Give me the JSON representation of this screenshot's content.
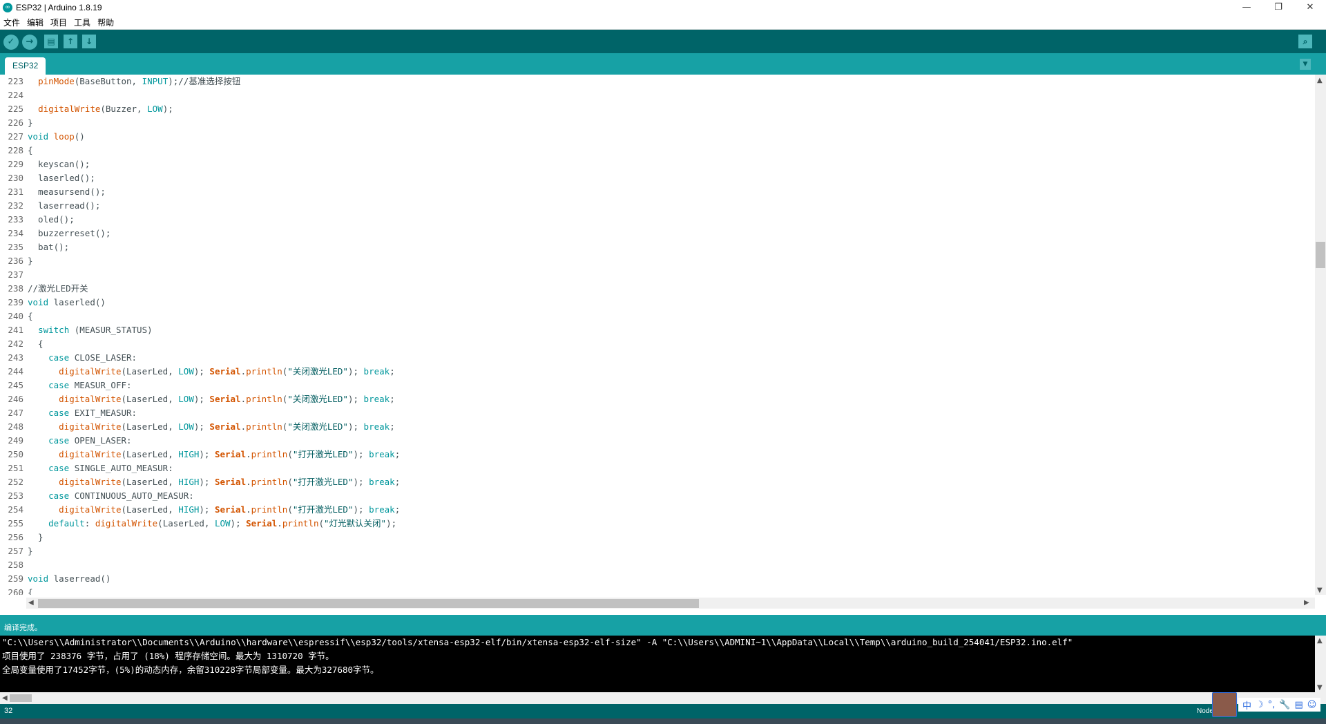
{
  "window": {
    "title": "ESP32 | Arduino 1.8.19",
    "controls": [
      "—",
      "❐",
      "✕"
    ]
  },
  "menu": [
    "文件",
    "编辑",
    "项目",
    "工具",
    "帮助"
  ],
  "toolbar": {
    "verify_icon": "✓",
    "upload_icon": "→",
    "new_icon": "▤",
    "open_icon": "↑",
    "save_icon": "↓",
    "serial_monitor_icon": "⌕"
  },
  "tab": {
    "label": "ESP32",
    "menu_icon": "▼"
  },
  "editor": {
    "lines": [
      {
        "n": "223",
        "segs": [
          [
            "  ",
            "code"
          ],
          [
            "pinMode",
            "fn"
          ],
          [
            "(BaseButton, ",
            "code"
          ],
          [
            "INPUT",
            "const"
          ],
          [
            ");//基准选择按钮",
            "code"
          ]
        ]
      },
      {
        "n": "224",
        "segs": []
      },
      {
        "n": "225",
        "segs": [
          [
            "  ",
            "code"
          ],
          [
            "digitalWrite",
            "fn"
          ],
          [
            "(Buzzer, ",
            "code"
          ],
          [
            "LOW",
            "const"
          ],
          [
            ");",
            "code"
          ]
        ]
      },
      {
        "n": "226",
        "segs": [
          [
            "}",
            "code"
          ]
        ]
      },
      {
        "n": "227",
        "segs": [
          [
            "void",
            "kw"
          ],
          [
            " ",
            "code"
          ],
          [
            "loop",
            "fn"
          ],
          [
            "()",
            "code"
          ]
        ]
      },
      {
        "n": "228",
        "segs": [
          [
            "{",
            "code"
          ]
        ]
      },
      {
        "n": "229",
        "segs": [
          [
            "  keyscan();",
            "code"
          ]
        ]
      },
      {
        "n": "230",
        "segs": [
          [
            "  laserled();",
            "code"
          ]
        ]
      },
      {
        "n": "231",
        "segs": [
          [
            "  measursend();",
            "code"
          ]
        ]
      },
      {
        "n": "232",
        "segs": [
          [
            "  laserread();",
            "code"
          ]
        ]
      },
      {
        "n": "233",
        "segs": [
          [
            "  oled();",
            "code"
          ]
        ]
      },
      {
        "n": "234",
        "segs": [
          [
            "  buzzerreset();",
            "code"
          ]
        ]
      },
      {
        "n": "235",
        "segs": [
          [
            "  bat();",
            "code"
          ]
        ]
      },
      {
        "n": "236",
        "segs": [
          [
            "}",
            "code"
          ]
        ]
      },
      {
        "n": "237",
        "segs": []
      },
      {
        "n": "238",
        "segs": [
          [
            "//激光LED开关",
            "cm"
          ]
        ]
      },
      {
        "n": "239",
        "segs": [
          [
            "void",
            "kw"
          ],
          [
            " laserled()",
            "code"
          ]
        ]
      },
      {
        "n": "240",
        "segs": [
          [
            "{",
            "code"
          ]
        ]
      },
      {
        "n": "241",
        "segs": [
          [
            "  ",
            "code"
          ],
          [
            "switch",
            "kw"
          ],
          [
            " (MEASUR_STATUS)",
            "code"
          ]
        ]
      },
      {
        "n": "242",
        "segs": [
          [
            "  {",
            "code"
          ]
        ]
      },
      {
        "n": "243",
        "segs": [
          [
            "    ",
            "code"
          ],
          [
            "case",
            "kw"
          ],
          [
            " CLOSE_LASER:",
            "code"
          ]
        ]
      },
      {
        "n": "244",
        "segs": [
          [
            "      ",
            "code"
          ],
          [
            "digitalWrite",
            "fn"
          ],
          [
            "(LaserLed, ",
            "code"
          ],
          [
            "LOW",
            "const"
          ],
          [
            "); ",
            "code"
          ],
          [
            "Serial",
            "obj"
          ],
          [
            ".",
            "code"
          ],
          [
            "println",
            "fn"
          ],
          [
            "(",
            "code"
          ],
          [
            "\"关闭激光LED\"",
            "str"
          ],
          [
            "); ",
            "code"
          ],
          [
            "break",
            "kw"
          ],
          [
            ";",
            "code"
          ]
        ]
      },
      {
        "n": "245",
        "segs": [
          [
            "    ",
            "code"
          ],
          [
            "case",
            "kw"
          ],
          [
            " MEASUR_OFF:",
            "code"
          ]
        ]
      },
      {
        "n": "246",
        "segs": [
          [
            "      ",
            "code"
          ],
          [
            "digitalWrite",
            "fn"
          ],
          [
            "(LaserLed, ",
            "code"
          ],
          [
            "LOW",
            "const"
          ],
          [
            "); ",
            "code"
          ],
          [
            "Serial",
            "obj"
          ],
          [
            ".",
            "code"
          ],
          [
            "println",
            "fn"
          ],
          [
            "(",
            "code"
          ],
          [
            "\"关闭激光LED\"",
            "str"
          ],
          [
            "); ",
            "code"
          ],
          [
            "break",
            "kw"
          ],
          [
            ";",
            "code"
          ]
        ]
      },
      {
        "n": "247",
        "segs": [
          [
            "    ",
            "code"
          ],
          [
            "case",
            "kw"
          ],
          [
            " EXIT_MEASUR:",
            "code"
          ]
        ]
      },
      {
        "n": "248",
        "segs": [
          [
            "      ",
            "code"
          ],
          [
            "digitalWrite",
            "fn"
          ],
          [
            "(LaserLed, ",
            "code"
          ],
          [
            "LOW",
            "const"
          ],
          [
            "); ",
            "code"
          ],
          [
            "Serial",
            "obj"
          ],
          [
            ".",
            "code"
          ],
          [
            "println",
            "fn"
          ],
          [
            "(",
            "code"
          ],
          [
            "\"关闭激光LED\"",
            "str"
          ],
          [
            "); ",
            "code"
          ],
          [
            "break",
            "kw"
          ],
          [
            ";",
            "code"
          ]
        ]
      },
      {
        "n": "249",
        "segs": [
          [
            "    ",
            "code"
          ],
          [
            "case",
            "kw"
          ],
          [
            " OPEN_LASER:",
            "code"
          ]
        ]
      },
      {
        "n": "250",
        "segs": [
          [
            "      ",
            "code"
          ],
          [
            "digitalWrite",
            "fn"
          ],
          [
            "(LaserLed, ",
            "code"
          ],
          [
            "HIGH",
            "const"
          ],
          [
            "); ",
            "code"
          ],
          [
            "Serial",
            "obj"
          ],
          [
            ".",
            "code"
          ],
          [
            "println",
            "fn"
          ],
          [
            "(",
            "code"
          ],
          [
            "\"打开激光LED\"",
            "str"
          ],
          [
            "); ",
            "code"
          ],
          [
            "break",
            "kw"
          ],
          [
            ";",
            "code"
          ]
        ]
      },
      {
        "n": "251",
        "segs": [
          [
            "    ",
            "code"
          ],
          [
            "case",
            "kw"
          ],
          [
            " SINGLE_AUTO_MEASUR:",
            "code"
          ]
        ]
      },
      {
        "n": "252",
        "segs": [
          [
            "      ",
            "code"
          ],
          [
            "digitalWrite",
            "fn"
          ],
          [
            "(LaserLed, ",
            "code"
          ],
          [
            "HIGH",
            "const"
          ],
          [
            "); ",
            "code"
          ],
          [
            "Serial",
            "obj"
          ],
          [
            ".",
            "code"
          ],
          [
            "println",
            "fn"
          ],
          [
            "(",
            "code"
          ],
          [
            "\"打开激光LED\"",
            "str"
          ],
          [
            "); ",
            "code"
          ],
          [
            "break",
            "kw"
          ],
          [
            ";",
            "code"
          ]
        ]
      },
      {
        "n": "253",
        "segs": [
          [
            "    ",
            "code"
          ],
          [
            "case",
            "kw"
          ],
          [
            " CONTINUOUS_AUTO_MEASUR:",
            "code"
          ]
        ]
      },
      {
        "n": "254",
        "segs": [
          [
            "      ",
            "code"
          ],
          [
            "digitalWrite",
            "fn"
          ],
          [
            "(LaserLed, ",
            "code"
          ],
          [
            "HIGH",
            "const"
          ],
          [
            "); ",
            "code"
          ],
          [
            "Serial",
            "obj"
          ],
          [
            ".",
            "code"
          ],
          [
            "println",
            "fn"
          ],
          [
            "(",
            "code"
          ],
          [
            "\"打开激光LED\"",
            "str"
          ],
          [
            "); ",
            "code"
          ],
          [
            "break",
            "kw"
          ],
          [
            ";",
            "code"
          ]
        ]
      },
      {
        "n": "255",
        "segs": [
          [
            "    ",
            "code"
          ],
          [
            "default",
            "kw"
          ],
          [
            ": ",
            "code"
          ],
          [
            "digitalWrite",
            "fn"
          ],
          [
            "(LaserLed, ",
            "code"
          ],
          [
            "LOW",
            "const"
          ],
          [
            "); ",
            "code"
          ],
          [
            "Serial",
            "obj"
          ],
          [
            ".",
            "code"
          ],
          [
            "println",
            "fn"
          ],
          [
            "(",
            "code"
          ],
          [
            "\"灯光默认关闭\"",
            "str"
          ],
          [
            ");",
            "code"
          ]
        ]
      },
      {
        "n": "256",
        "segs": [
          [
            "  }",
            "code"
          ]
        ]
      },
      {
        "n": "257",
        "segs": [
          [
            "}",
            "code"
          ]
        ]
      },
      {
        "n": "258",
        "segs": []
      },
      {
        "n": "259",
        "segs": [
          [
            "void",
            "kw"
          ],
          [
            " laserread()",
            "code"
          ]
        ]
      },
      {
        "n": "260",
        "segs": [
          [
            "{",
            "code"
          ]
        ]
      }
    ]
  },
  "status": {
    "message": "编译完成。"
  },
  "console": {
    "lines": [
      "\"C:\\\\Users\\\\Administrator\\\\Documents\\\\Arduino\\\\hardware\\\\espressif\\\\esp32/tools/xtensa-esp32-elf/bin/xtensa-esp32-elf-size\" -A \"C:\\\\Users\\\\ADMINI~1\\\\AppData\\\\Local\\\\Temp\\\\arduino_build_254041/ESP32.ino.elf\"",
      "项目使用了 238376 字节，占用了 (18%) 程序存储空间。最大为 1310720 字节。",
      "全局变量使用了17452字节，(5%)的动态内存，余留310228字节局部变量。最大为327680字节。"
    ]
  },
  "footer": {
    "line_number": "32",
    "board": "Node"
  },
  "ime": {
    "icons": [
      "中",
      "☽",
      "°,",
      "🔧",
      "▤",
      "☺"
    ]
  },
  "colors": {
    "toolbar": "#006468",
    "tabbar": "#17a1a5",
    "console_bg": "#000000"
  }
}
